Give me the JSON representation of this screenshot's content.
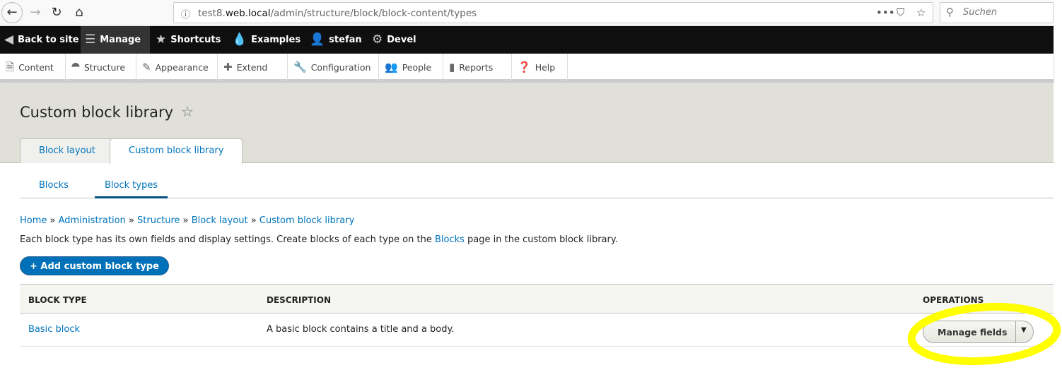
{
  "browser": {
    "url_host_pre": "test8.",
    "url_host": "web.local",
    "url_path": "/admin/structure/block/block-content/types",
    "search_placeholder": "Suchen"
  },
  "toolbar": {
    "items": [
      {
        "label": "Back to site"
      },
      {
        "label": "Manage"
      },
      {
        "label": "Shortcuts"
      },
      {
        "label": "Examples"
      },
      {
        "label": "stefan"
      },
      {
        "label": "Devel"
      }
    ]
  },
  "tray": {
    "items": [
      {
        "label": "Content"
      },
      {
        "label": "Structure"
      },
      {
        "label": "Appearance"
      },
      {
        "label": "Extend"
      },
      {
        "label": "Configuration"
      },
      {
        "label": "People"
      },
      {
        "label": "Reports"
      },
      {
        "label": "Help"
      }
    ]
  },
  "header": {
    "title": "Custom block library",
    "tabs": [
      {
        "label": "Block layout"
      },
      {
        "label": "Custom block library"
      }
    ]
  },
  "subtabs": [
    {
      "label": "Blocks"
    },
    {
      "label": "Block types"
    }
  ],
  "breadcrumb": [
    "Home",
    "Administration",
    "Structure",
    "Block layout",
    "Custom block library"
  ],
  "breadcrumb_sep": "»",
  "description": {
    "pre": "Each block type has its own fields and display settings. Create blocks of each type on the ",
    "link": "Blocks",
    "post": " page in the custom block library."
  },
  "add_button": "+ Add custom block type",
  "table": {
    "headers": [
      "Block type",
      "Description",
      "Operations"
    ],
    "rows": [
      {
        "name": "Basic block",
        "description": "A basic block contains a title and a body.",
        "operation": "Manage fields"
      }
    ]
  },
  "highlight_color": "#ffff00"
}
